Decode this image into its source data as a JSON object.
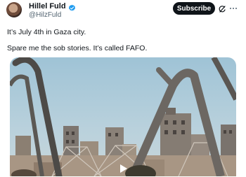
{
  "author": {
    "display_name": "Hillel Fuld",
    "handle": "@HilzFuld",
    "verified": true
  },
  "actions": {
    "subscribe_label": "Subscribe",
    "grok_icon": "grok-icon",
    "more_icon": "more-icon"
  },
  "tweet": {
    "line1": "It’s July 4th in Gaza city.",
    "line2": "Spare me the sob stories. It’s called FAFO."
  },
  "media": {
    "type": "video",
    "play_icon": "play-icon"
  },
  "colors": {
    "verified": "#1d9bf0",
    "subscribe_bg": "#0f1419",
    "handle": "#536471"
  }
}
